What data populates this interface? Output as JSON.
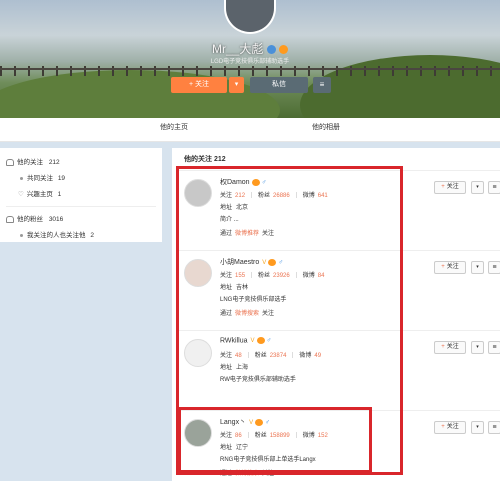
{
  "profile": {
    "username": "Mr__大彪",
    "bio": "LGD电子竞技俱乐部辅助选手",
    "follow_label": "+ 关注",
    "dropdown_label": "▾",
    "message_label": "私信",
    "more_label": "≡"
  },
  "tabs": [
    {
      "label": "他的主页"
    },
    {
      "label": "他的相册"
    }
  ],
  "sidebar": {
    "following": {
      "label": "他的关注",
      "count": "212"
    },
    "following_sub": [
      {
        "label": "共同关注",
        "count": "19"
      },
      {
        "label": "兴趣主页",
        "count": "1"
      }
    ],
    "fans": {
      "label": "他的粉丝",
      "count": "3016"
    },
    "fans_sub": [
      {
        "label": "我关注的人也关注他",
        "count": "2"
      }
    ]
  },
  "main": {
    "title": "他的关注 212",
    "follow_button_label": "关注",
    "follow_plus": "+",
    "drop_label": "▾",
    "more_label": "≡",
    "labels": {
      "following": "关注",
      "fans": "粉丝",
      "posts": "微博",
      "address": "地址",
      "intro": "简介",
      "via": "通过",
      "follow_suffix": "关注"
    },
    "users": [
      {
        "name": "权Damon",
        "verified": "",
        "following": "212",
        "fans": "26886",
        "posts": "641",
        "address": "北京",
        "intro": "简介 ...",
        "via_link": "微博推荐"
      },
      {
        "name": "小胡Maestro",
        "verified": "V",
        "following": "155",
        "fans": "23926",
        "posts": "84",
        "address": "吉林",
        "intro": "LNG电子竞技俱乐部选手",
        "via_link": "微博搜索"
      },
      {
        "name": "RWkillua",
        "verified": "V",
        "following": "48",
        "fans": "23874",
        "posts": "49",
        "address": "上海",
        "intro": "RW电子竞技俱乐部辅助选手",
        "via_link": ""
      },
      {
        "name": "Langx丶",
        "verified": "V",
        "following": "86",
        "fans": "158899",
        "posts": "152",
        "address": "辽宁",
        "intro": "RNG电子竞技俱乐部上单选手Langx",
        "via_link": "微博搜索"
      }
    ]
  },
  "colors": {
    "accent_orange": "#ff8140",
    "number_orange": "#eb7350",
    "highlight_red": "#d9262b"
  }
}
